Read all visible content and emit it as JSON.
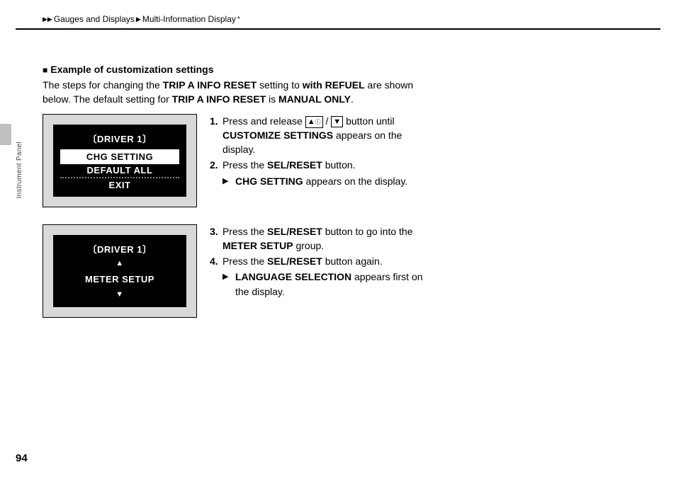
{
  "breadcrumb": {
    "a": "Gauges and Displays",
    "b": "Multi-Information Display",
    "star": "*"
  },
  "sideTab": "Instrument Panel",
  "pageNumber": "94",
  "section": {
    "title": "Example of customization settings",
    "intro_pre": "The steps for changing the ",
    "intro_b1": "TRIP A INFO RESET",
    "intro_mid1": " setting to ",
    "intro_b2": "with REFUEL",
    "intro_mid2": " are shown below. The default setting for ",
    "intro_b3": "TRIP A INFO RESET",
    "intro_mid3": " is ",
    "intro_b4": "MANUAL ONLY",
    "intro_end": "."
  },
  "screenA": {
    "header": "〔DRIVER 1〕",
    "opt1": "CHG SETTING",
    "opt2": "DEFAULT ALL",
    "opt3": "EXIT"
  },
  "screenB": {
    "header": "〔DRIVER 1〕",
    "title": "METER SETUP"
  },
  "steps1": [
    {
      "n": "1.",
      "pre": "Press and release ",
      "post": " button until ",
      "b": "CUSTOMIZE SETTINGS",
      "tail": " appears on the display."
    },
    {
      "n": "2.",
      "pre": "Press the ",
      "b": "SEL/RESET",
      "tail": " button."
    }
  ],
  "sub1": {
    "b": "CHG SETTING",
    "tail": " appears on the display."
  },
  "steps2": [
    {
      "n": "3.",
      "pre": "Press the ",
      "b": "SEL/RESET",
      "tail": " button to go into the ",
      "b2": "METER SETUP",
      "tail2": " group."
    },
    {
      "n": "4.",
      "pre": "Press the ",
      "b": "SEL/RESET",
      "tail": " button again."
    }
  ],
  "sub2": {
    "b": "LANGUAGE SELECTION",
    "tail": " appears first on the display."
  }
}
